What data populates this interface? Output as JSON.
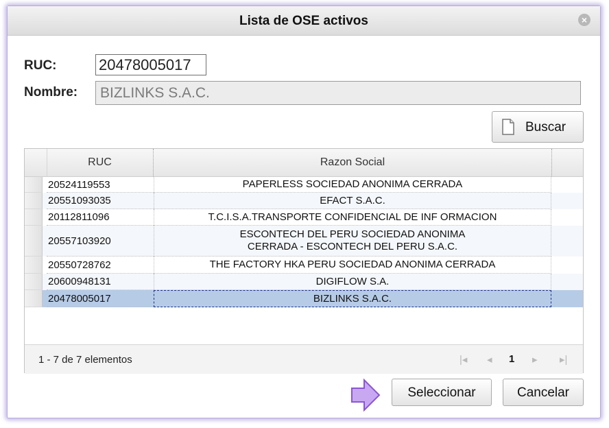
{
  "dialog": {
    "title": "Lista de OSE activos",
    "close_icon": "close-icon"
  },
  "form": {
    "ruc_label": "RUC:",
    "ruc_value": "20478005017",
    "nombre_label": "Nombre:",
    "nombre_value": "BIZLINKS S.A.C.",
    "buscar_label": "Buscar"
  },
  "grid": {
    "columns": [
      "RUC",
      "Razon Social"
    ],
    "rows": [
      {
        "ruc": "20524119553",
        "razon": "PAPERLESS SOCIEDAD ANONIMA CERRADA"
      },
      {
        "ruc": "20551093035",
        "razon": "EFACT S.A.C."
      },
      {
        "ruc": "20112811096",
        "razon": "T.C.I.S.A.TRANSPORTE CONFIDENCIAL DE INF ORMACION"
      },
      {
        "ruc": "20557103920",
        "razon": "ESCONTECH DEL PERU SOCIEDAD ANONIMA CERRADA - ESCONTECH DEL PERU S.A.C."
      },
      {
        "ruc": "20550728762",
        "razon": "THE FACTORY HKA PERU SOCIEDAD ANONIMA CERRADA"
      },
      {
        "ruc": "20600948131",
        "razon": "DIGIFLOW S.A."
      },
      {
        "ruc": "20478005017",
        "razon": "BIZLINKS S.A.C."
      }
    ],
    "selected_row": 7,
    "footer_text": "1 - 7 de 7 elementos",
    "pager": {
      "first": "|◂",
      "prev": "◂",
      "page": "1",
      "next": "▸",
      "last": "▸|"
    }
  },
  "actions": {
    "seleccionar_label": "Seleccionar",
    "cancelar_label": "Cancelar"
  },
  "colors": {
    "accent_border": "#b9a8e0",
    "selected_row": "#b6cbe6",
    "arrow": "#c9a8f2"
  }
}
